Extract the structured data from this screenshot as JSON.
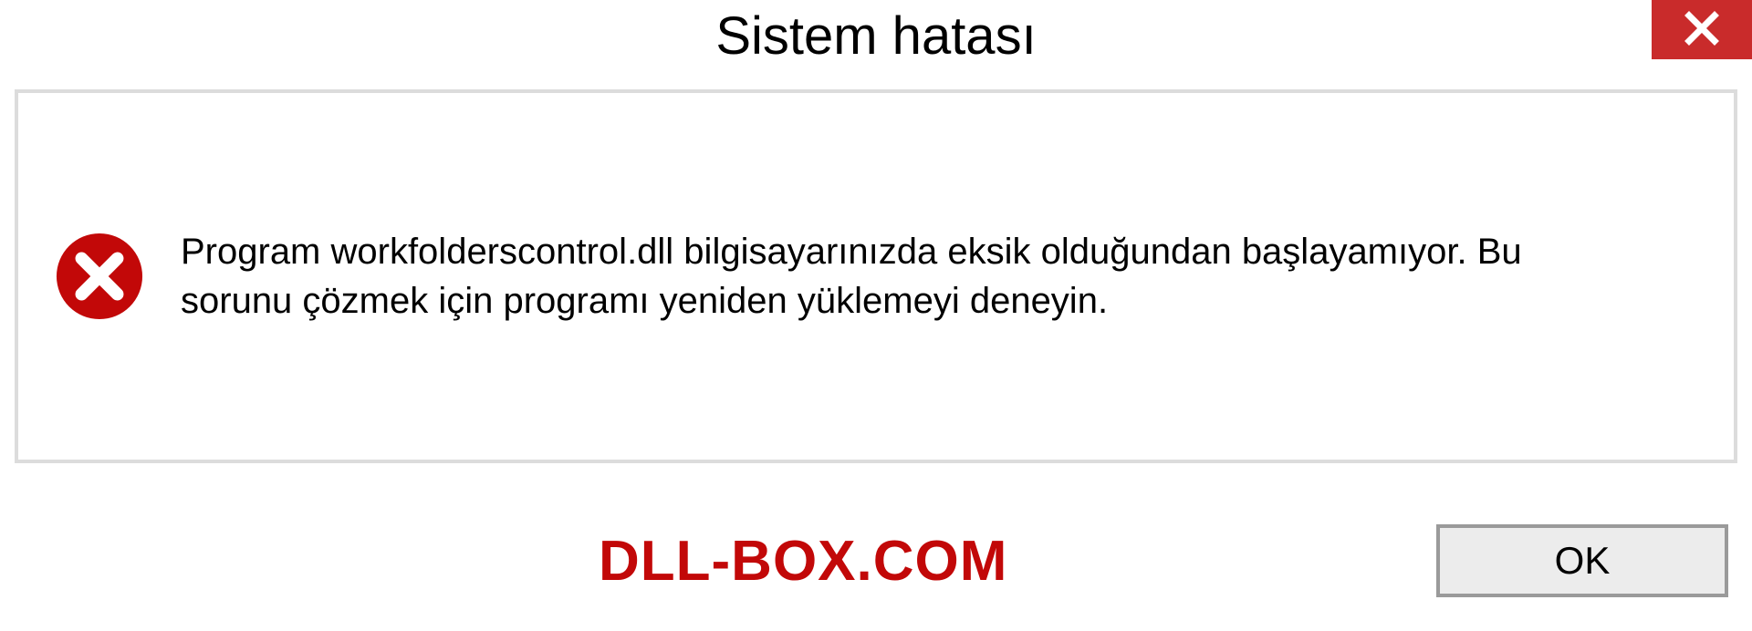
{
  "title": "Sistem hatası",
  "message": "Program workfolderscontrol.dll bilgisayarınızda eksik olduğundan başlayamıyor. Bu sorunu çözmek için programı yeniden yüklemeyi deneyin.",
  "ok_label": "OK",
  "watermark": "DLL-BOX.COM",
  "colors": {
    "close_bg": "#c92b2b",
    "error_icon": "#c20808",
    "watermark": "#c20808",
    "border": "#dcdcdc"
  },
  "icons": {
    "close": "close-icon",
    "error": "error-circle-x-icon"
  }
}
